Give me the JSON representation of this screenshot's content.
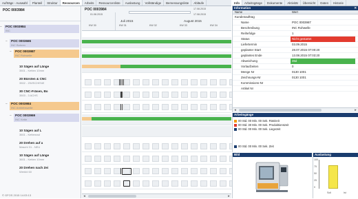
{
  "tabs_left": [
    "Aufträge - Auswahl",
    "Planteil",
    "Struktur",
    "Ressourcen",
    "Arbeits",
    "Ressourcenliste",
    "Auslastung",
    "Vollständige",
    "Bemessungsliste",
    "Abläufe"
  ],
  "tabs_right": [
    "Info",
    "Arbeitsgänge",
    "Dokumente",
    "Aktivität",
    "Übersicht",
    "Daten",
    "Historie"
  ],
  "tree": {
    "header": "POC 0003984",
    "nodes": [
      {
        "title": "POC 0003984",
        "sub": "INC",
        "style": "lav",
        "expander": "−"
      },
      {
        "title": "POC 0003665",
        "sub": "INC Bohren",
        "style": "lav",
        "expander": "−"
      },
      {
        "title": "POC 0003987",
        "sub": "INC Rohwelle",
        "style": "orange",
        "expander": "−"
      },
      {
        "title": "10 Sägen auf Länge",
        "sub": "3501 - Ketten 10mm",
        "style": "none"
      },
      {
        "title": "20 Bürsten & CNC",
        "sub": "3502 - ZWISCHENE",
        "style": "none"
      },
      {
        "title": "30 CNC-Fräsen, Bo",
        "sub": "3503 - 3 ACHS",
        "style": "none"
      },
      {
        "title": "POC 0003984",
        "sub": "INC Antriebswelle",
        "style": "orange",
        "expander": "−"
      },
      {
        "title": "POC 0003969",
        "sub": "INC Kette",
        "style": "lav",
        "expander": "−"
      },
      {
        "title": "10 Sägen auf L",
        "sub": "3601 - Kettenrad",
        "style": "none"
      },
      {
        "title": "20 Drehen auf a",
        "sub": "Maschi 31 - NEU",
        "style": "none"
      },
      {
        "title": "10 Sägen auf Länge",
        "sub": "3601 - Ketten 10mm",
        "style": "none"
      },
      {
        "title": "20 Drehen nach Zei",
        "sub": "Werkbl 60",
        "style": "none"
      }
    ],
    "footer": "© GFOS 2015 14:03:13"
  },
  "gantt": {
    "title": "POC 0003984",
    "date_start": "01.08.2015",
    "date_end": "17.08.2015",
    "date_end2": "17.08.2015",
    "months": [
      "Juli 2015",
      "August 2015"
    ],
    "weeks": [
      "KW 30",
      "KW 31",
      "KW 32",
      "KW 33",
      "KW 34"
    ]
  },
  "info": {
    "title": "Information",
    "col_name": "Name",
    "col_value": "Wert",
    "group": "Kundenauftrag",
    "rows": [
      {
        "k": "Name",
        "v": "POC 0003987",
        "style": ""
      },
      {
        "k": "Beschreibung",
        "v": "INC Rohwelle",
        "style": ""
      },
      {
        "k": "Reihefolge",
        "v": "1",
        "style": ""
      },
      {
        "k": "Status",
        "v": "Nicht gestartet",
        "style": "red"
      },
      {
        "k": "Liefertermin",
        "v": "03.09.2015",
        "style": ""
      },
      {
        "k": "geplanter Start",
        "v": "28.07.2015 07:00:20",
        "style": ""
      },
      {
        "k": "geplantes Ende",
        "v": "13.08.2015 07:03:20",
        "style": ""
      },
      {
        "k": "Abweichung",
        "v": "35d",
        "style": "green"
      },
      {
        "k": "Vorlaufzeiten",
        "v": "0",
        "style": ""
      },
      {
        "k": "Menge Nr",
        "v": "0130 1001",
        "style": ""
      },
      {
        "k": "Zeichnungs-Nr",
        "v": "0130 1001",
        "style": ""
      },
      {
        "k": "Kommissions-Nr",
        "v": "",
        "style": ""
      },
      {
        "k": "Artikel Nr",
        "v": "",
        "style": ""
      }
    ]
  },
  "steps": {
    "title": "Arbeitsgänge",
    "items": [
      {
        "label": "00 Std. 00 Min. 00 Sek. Rüstzeit",
        "color": "#f39c12"
      },
      {
        "label": "00 Std. 30 Min. 00 Sek. Produktionszeit",
        "color": "#e33b2f"
      },
      {
        "label": "00 Std. 00 Min. 00 Sek. Liegezeit",
        "color": "#1a3c6e"
      }
    ],
    "bottom": "00 Std. 00 Min. 00 Sek. Zeit"
  },
  "image_panel": {
    "title": "Bild"
  },
  "util": {
    "title": "Auslastung",
    "yticks": [
      "100",
      "75",
      "50",
      "25",
      "0"
    ],
    "xlabels": [
      "Soll",
      "Ist"
    ],
    "value_pct": 85
  }
}
